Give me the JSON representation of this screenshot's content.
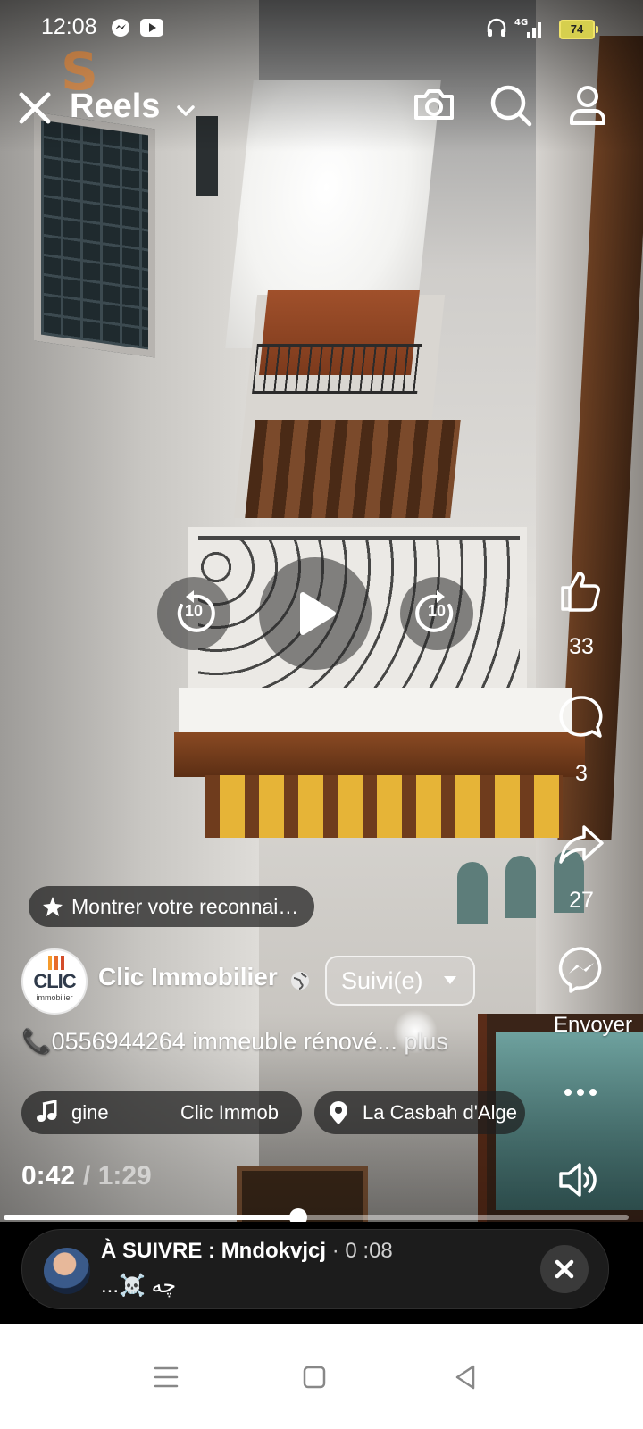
{
  "status_bar": {
    "time": "12:08",
    "battery": "74",
    "icons": [
      "messenger-icon",
      "youtube-icon",
      "headphones-icon",
      "signal-4g-icon",
      "battery-icon"
    ]
  },
  "header": {
    "title": "Reels",
    "icons": [
      "close-icon",
      "chevron-down-icon",
      "camera-icon",
      "search-icon",
      "profile-icon"
    ]
  },
  "watermark": "S",
  "playback": {
    "rewind_label": "10",
    "forward_label": "10",
    "icons": [
      "rewind-10-icon",
      "play-icon",
      "forward-10-icon"
    ]
  },
  "actions": {
    "likes": "33",
    "comments": "3",
    "shares": "27",
    "send_label": "Envoyer"
  },
  "recognition_button": "Montrer votre reconnai…",
  "channel": {
    "avatar_text": "CLIC",
    "avatar_subtext": "immobilier",
    "name": "Clic Immobilier",
    "follow_label": "Suivi(e)"
  },
  "caption": {
    "text": "📞0556944264 immeuble rénové...",
    "more": "plus"
  },
  "audio": {
    "title": "gine",
    "artist": "Clic Immob"
  },
  "location": "La Casbah d'Alge",
  "video_time": {
    "current": "0:42",
    "separator": "/",
    "total": "1:29",
    "progress": 0.472
  },
  "up_next": {
    "label": "À SUIVRE :",
    "channel": "Mndokvjcj",
    "duration": "· 0 :08",
    "subtitle": "...☠️ چه"
  },
  "colors": {
    "battery": "#d6cf4e",
    "watermark": "#f07d1c",
    "accent": "#ffffff"
  }
}
